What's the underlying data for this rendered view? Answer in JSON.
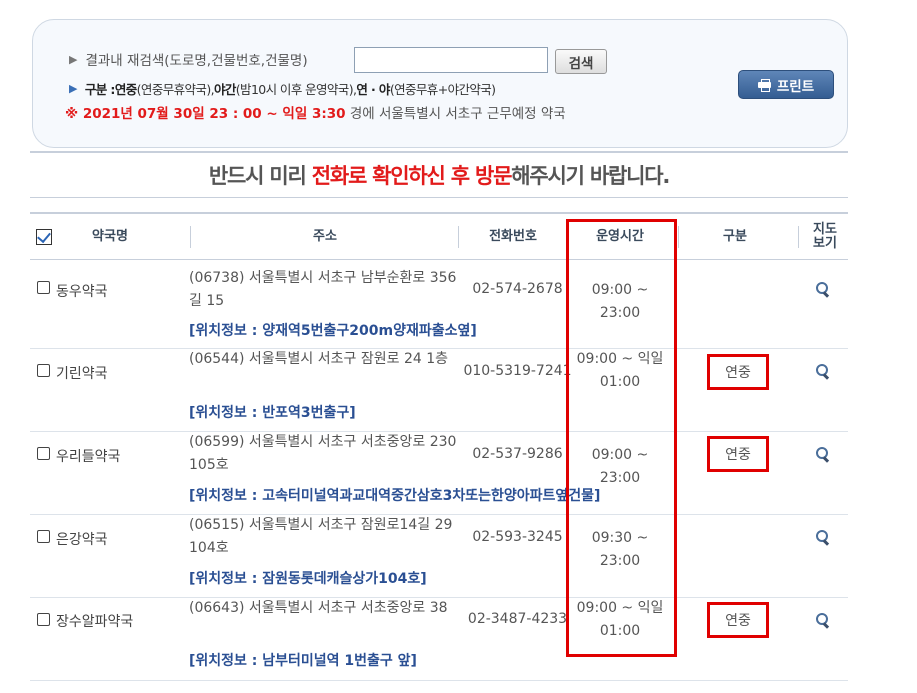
{
  "search": {
    "label": "결과내 재검색(도로명,건물번호,건물명)",
    "input_value": "",
    "button": "검색"
  },
  "legend": {
    "prefix": "구분 : ",
    "t1": "연중",
    "d1": "(연중무휴약국), ",
    "t2": "야간",
    "d2": "(밤10시 이후 운영약국), ",
    "t3": "연 · 야",
    "d3": "(연중무휴+야간약국)"
  },
  "period": {
    "red": "※ 2021년 07월 30일 23 : 00 ~ 익일 3:30",
    "rest": " 경에  서울특별시  서초구   근무예정 약국"
  },
  "print_button": "프린트",
  "notice": {
    "a": "반드시 미리 ",
    "b": "전화로 확인하신 후 방문",
    "c": "해주시기 바랍니다."
  },
  "table": {
    "headers": {
      "name": "약국명",
      "address": "주소",
      "phone": "전화번호",
      "hours": "운영시간",
      "type": "구분",
      "map": "지도보기"
    },
    "rows": [
      {
        "name": "동우약국",
        "address": "(06738) 서울특별시 서초구 남부순환로 356길 15",
        "phone": "02-574-2678",
        "hours": "09:00 ~ 23:00",
        "type": "",
        "location": "[위치정보 : 양재역5번출구200m양재파출소옆]"
      },
      {
        "name": "기린약국",
        "address": "(06544) 서울특별시 서초구 잠원로 24 1층",
        "phone": "010-5319-7241",
        "hours": "09:00 ~ 익일 01:00",
        "type": "연중",
        "location": "[위치정보 : 반포역3번출구]"
      },
      {
        "name": "우리들약국",
        "address": "(06599) 서울특별시 서초구 서초중앙로 230 105호",
        "phone": "02-537-9286",
        "hours": "09:00 ~ 23:00",
        "type": "연중",
        "location": "[위치정보 : 고속터미널역과교대역중간삼호3차또는한양아파트옆건물]"
      },
      {
        "name": "은강약국",
        "address": "(06515) 서울특별시 서초구 잠원로14길 29 104호",
        "phone": "02-593-3245",
        "hours": "09:30 ~ 23:00",
        "type": "",
        "location": "[위치정보 : 잠원동롯데캐슬상가104호]"
      },
      {
        "name": "장수알파약국",
        "address": "(06643) 서울특별시 서초구 서초중앙로 38",
        "phone": "02-3487-4233",
        "hours": "09:00 ~ 익일 01:00",
        "type": "연중",
        "location": "[위치정보 : 남부터미널역 1번출구 앞]"
      }
    ]
  }
}
